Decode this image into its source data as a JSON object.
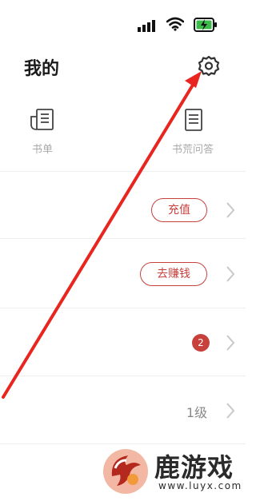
{
  "status_bar": {
    "signal_icon": "signal-bars-icon",
    "wifi_icon": "wifi-icon",
    "battery_icon": "battery-charging-icon",
    "battery_color": "#3dbb4a"
  },
  "header": {
    "title": "我的",
    "settings_icon": "gear-icon"
  },
  "shortcuts": [
    {
      "label": "书单",
      "icon": "book-list-icon"
    },
    {
      "label": "书荒问答",
      "icon": "qa-document-icon"
    }
  ],
  "rows": [
    {
      "button_label": "充值"
    },
    {
      "button_label": "去赚钱"
    },
    {
      "badge_count": "2"
    },
    {
      "level_text": "1级"
    }
  ],
  "watermark": {
    "name": "鹿游戏",
    "url": "www.luyx.com"
  },
  "colors": {
    "accent": "#c8403c",
    "annotation_arrow": "#e8261f"
  }
}
